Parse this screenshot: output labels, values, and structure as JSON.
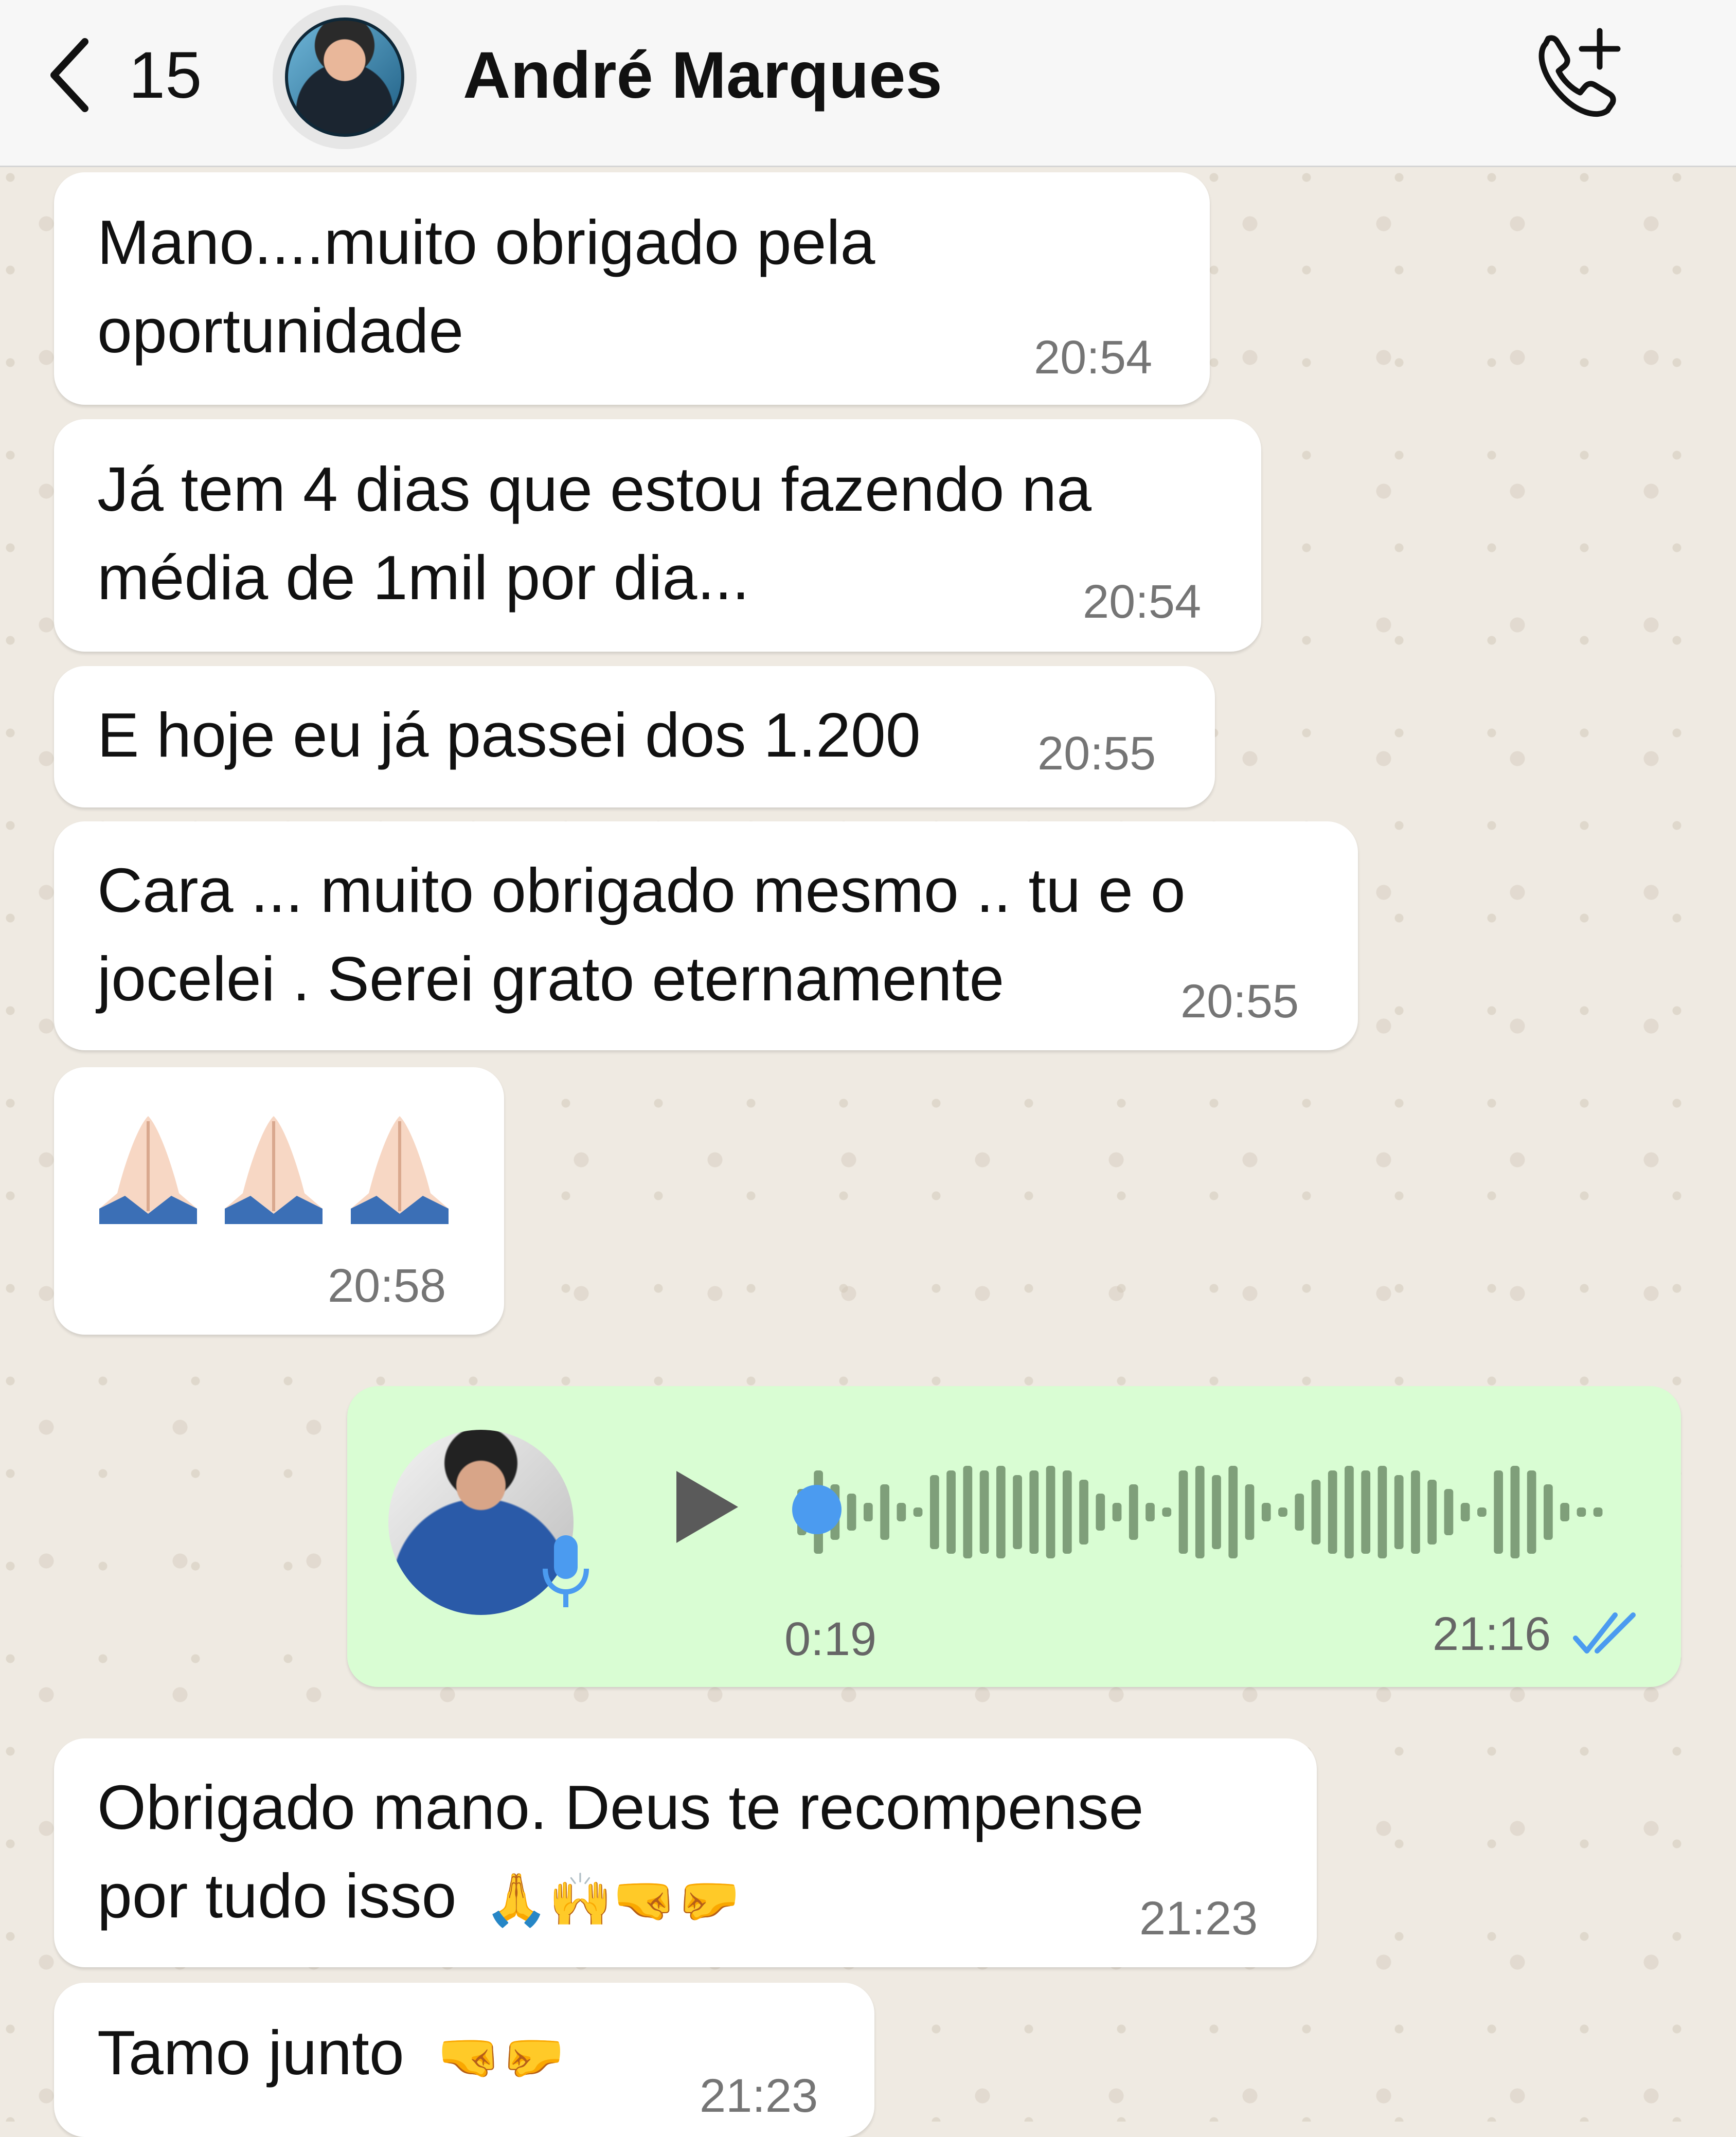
{
  "header": {
    "unread_count": "15",
    "contact_name": "André Marques"
  },
  "messages": [
    {
      "lines": [
        "Mano....muito obrigado pela",
        "oportunidade"
      ],
      "time": "20:54"
    },
    {
      "lines": [
        "Já tem 4 dias que estou fazendo na",
        "média de 1mil por dia..."
      ],
      "time": "20:54"
    },
    {
      "lines": [
        "E hoje eu já passei dos 1.200"
      ],
      "time": "20:55"
    },
    {
      "lines": [
        "Cara ... muito obrigado mesmo .. tu e o",
        "jocelei .  Serei grato eternamente"
      ],
      "time": "20:55"
    },
    {
      "emoji": "🙏🙏🙏",
      "time": "20:58"
    },
    {
      "lines": [
        "Obrigado mano. Deus te recompense",
        "por tudo isso"
      ],
      "emoji_suffix": "🙏🙌🤜🤛",
      "time": "21:23"
    },
    {
      "lines": [
        "Tamo junto"
      ],
      "emoji_suffix": "🤜🤛",
      "time": "21:23"
    }
  ],
  "voice_note": {
    "duration": "0:19",
    "time": "21:16",
    "status": "read"
  },
  "colors": {
    "incoming_bubble": "#ffffff",
    "outgoing_bubble": "#d9fdd3",
    "read_ticks": "#4b9bf0",
    "chat_bg": "#efeae2"
  },
  "icons": [
    "back-chevron-icon",
    "call-add-icon",
    "play-icon",
    "mic-icon",
    "double-check-icon"
  ]
}
